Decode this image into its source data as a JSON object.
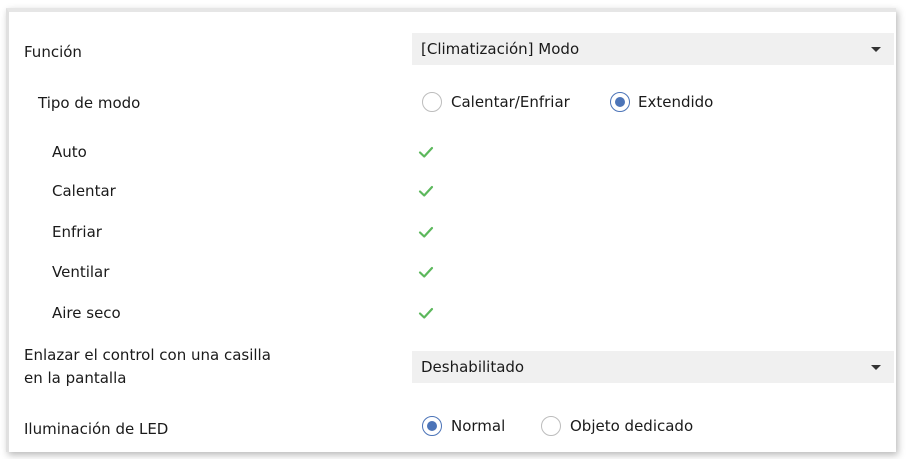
{
  "colors": {
    "accent": "#4c74b8",
    "check": "#5cb85c",
    "field_bg": "#f0f0f0"
  },
  "funcion": {
    "label": "Función",
    "value": "[Climatización] Modo"
  },
  "tipo_modo": {
    "label": "Tipo de modo",
    "options": [
      {
        "label": "Calentar/Enfriar",
        "selected": false
      },
      {
        "label": "Extendido",
        "selected": true
      }
    ]
  },
  "modes": [
    {
      "label": "Auto",
      "checked": true
    },
    {
      "label": "Calentar",
      "checked": true
    },
    {
      "label": "Enfriar",
      "checked": true
    },
    {
      "label": "Ventilar",
      "checked": true
    },
    {
      "label": "Aire seco",
      "checked": true
    }
  ],
  "enlazar": {
    "label_line1": "Enlazar el control con una casilla",
    "label_line2": "en la pantalla",
    "value": "Deshabilitado"
  },
  "led": {
    "label": "Iluminación de LED",
    "options": [
      {
        "label": "Normal",
        "selected": true
      },
      {
        "label": "Objeto dedicado",
        "selected": false
      }
    ]
  }
}
